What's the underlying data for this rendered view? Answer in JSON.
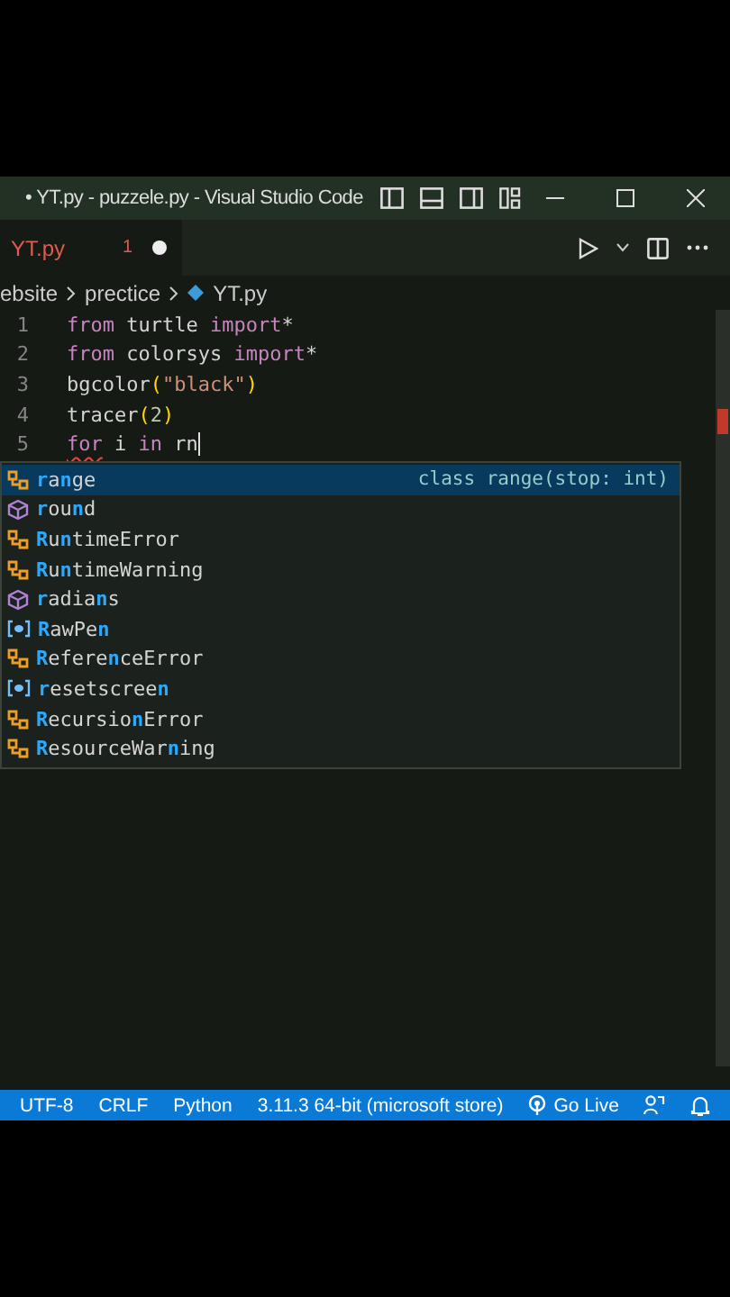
{
  "window": {
    "title": "• YT.py - puzzele.py - Visual Studio Code"
  },
  "tabs": [
    {
      "label": "YT.py",
      "problems": "1",
      "modified": true
    }
  ],
  "breadcrumb": [
    "ebsite",
    "prectice",
    "YT.py"
  ],
  "code_lines": [
    {
      "number": "1",
      "tokens": [
        {
          "text": "from",
          "kind": "kw"
        },
        {
          "text": " turtle ",
          "kind": "plain"
        },
        {
          "text": "import",
          "kind": "kw"
        },
        {
          "text": "*",
          "kind": "plain"
        }
      ]
    },
    {
      "number": "2",
      "tokens": [
        {
          "text": "from",
          "kind": "kw"
        },
        {
          "text": " colorsys ",
          "kind": "plain"
        },
        {
          "text": "import",
          "kind": "kw"
        },
        {
          "text": "*",
          "kind": "plain"
        }
      ]
    },
    {
      "number": "3",
      "tokens": [
        {
          "text": "bgcolor",
          "kind": "plain"
        },
        {
          "text": "(",
          "kind": "paren"
        },
        {
          "text": "\"black\"",
          "kind": "str"
        },
        {
          "text": ")",
          "kind": "paren"
        }
      ]
    },
    {
      "number": "4",
      "tokens": [
        {
          "text": "tracer",
          "kind": "plain"
        },
        {
          "text": "(",
          "kind": "paren"
        },
        {
          "text": "2",
          "kind": "num"
        },
        {
          "text": ")",
          "kind": "paren"
        }
      ]
    },
    {
      "number": "5",
      "tokens": [
        {
          "text": "for",
          "kind": "kw",
          "squiggle": true
        },
        {
          "text": " i ",
          "kind": "plain"
        },
        {
          "text": "in",
          "kind": "kw"
        },
        {
          "text": " rn",
          "kind": "plain"
        }
      ]
    }
  ],
  "suggestions": [
    {
      "label": "**r**a**n**ge",
      "kind": "class",
      "selected": true,
      "detail": "class range(stop: int)"
    },
    {
      "label": "**r**ou**n**d",
      "kind": "function",
      "selected": false
    },
    {
      "label": "**R**u**n**timeError",
      "kind": "class",
      "selected": false
    },
    {
      "label": "**R**u**n**timeWarning",
      "kind": "class",
      "selected": false
    },
    {
      "label": "**r**adia**n**s",
      "kind": "function",
      "selected": false
    },
    {
      "label": "**R**awPe**n**",
      "kind": "variable",
      "selected": false
    },
    {
      "label": "**R**efere**n**ceError",
      "kind": "class",
      "selected": false
    },
    {
      "label": "**r**esetscree**n**",
      "kind": "variable",
      "selected": false
    },
    {
      "label": "**R**ecursio**n**Error",
      "kind": "class",
      "selected": false
    },
    {
      "label": "**R**esourceWar**n**ing",
      "kind": "class",
      "selected": false
    }
  ],
  "status_bar": {
    "items": [
      "UTF-8",
      "CRLF",
      "Python",
      "3.11.3 64-bit (microsoft store)"
    ],
    "go_live": "Go Live"
  }
}
